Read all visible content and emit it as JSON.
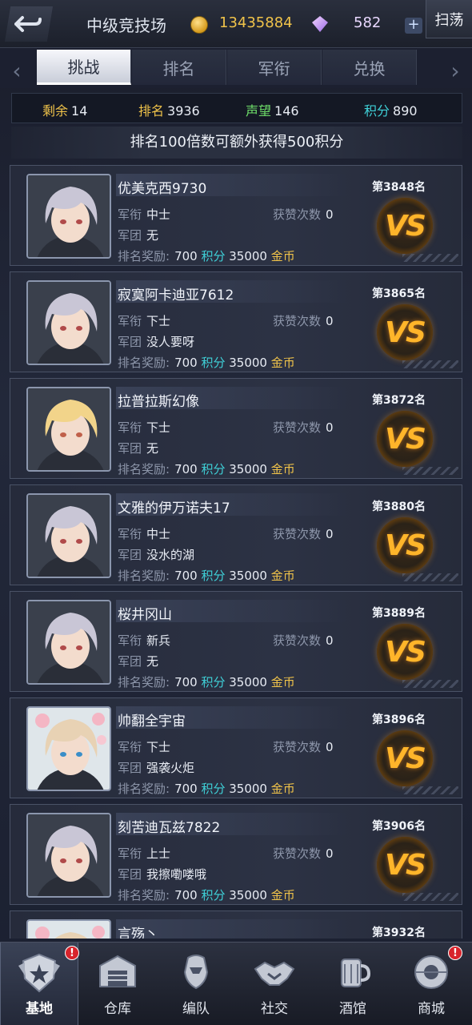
{
  "header": {
    "title": "中级竞技场",
    "gold": "13435884",
    "gems": "582",
    "plus": "+",
    "sweep": "扫荡"
  },
  "tabs": [
    {
      "label": "挑战",
      "active": true
    },
    {
      "label": "排名",
      "active": false
    },
    {
      "label": "军衔",
      "active": false
    },
    {
      "label": "兑换",
      "active": false
    }
  ],
  "stats": {
    "remaining_label": "剩余",
    "remaining": "14",
    "rank_label": "排名",
    "rank": "3936",
    "prestige_label": "声望",
    "prestige": "146",
    "points_label": "积分",
    "points": "890"
  },
  "notice": "排名100倍数可额外获得500积分",
  "labels": {
    "military_rank": "军衔",
    "legion": "军团",
    "likes": "获赞次数",
    "reward": "排名奖励:",
    "points_unit": "积分",
    "gold_unit": "金币",
    "vs": "VS"
  },
  "opponents": [
    {
      "name": "优美克西9730",
      "rank": "第3848名",
      "military_rank": "中士",
      "legion": "无",
      "likes": "0",
      "reward_points": "700",
      "reward_gold": "35000",
      "avatar": "silver-hair"
    },
    {
      "name": "寂寞阿卡迪亚7612",
      "rank": "第3865名",
      "military_rank": "下士",
      "legion": "没人要呀",
      "likes": "0",
      "reward_points": "700",
      "reward_gold": "35000",
      "avatar": "silver-hair"
    },
    {
      "name": "拉普拉斯幻像",
      "rank": "第3872名",
      "military_rank": "下士",
      "legion": "无",
      "likes": "0",
      "reward_points": "700",
      "reward_gold": "35000",
      "avatar": "blonde"
    },
    {
      "name": "文雅的伊万诺夫17",
      "rank": "第3880名",
      "military_rank": "中士",
      "legion": "没水的湖",
      "likes": "0",
      "reward_points": "700",
      "reward_gold": "35000",
      "avatar": "silver-hair"
    },
    {
      "name": "桜井冈山",
      "rank": "第3889名",
      "military_rank": "新兵",
      "legion": "无",
      "likes": "0",
      "reward_points": "700",
      "reward_gold": "35000",
      "avatar": "silver-hair"
    },
    {
      "name": "帅翻全宇宙",
      "rank": "第3896名",
      "military_rank": "下士",
      "legion": "强袭火炬",
      "likes": "0",
      "reward_points": "700",
      "reward_gold": "35000",
      "avatar": "flower-girl"
    },
    {
      "name": "刻苦迪瓦兹7822",
      "rank": "第3906名",
      "military_rank": "上士",
      "legion": "我擦嘞喽哦",
      "likes": "0",
      "reward_points": "700",
      "reward_gold": "35000",
      "avatar": "silver-hair"
    },
    {
      "name": "言殇丶",
      "rank": "第3932名",
      "military_rank": "",
      "legion": "",
      "likes": "",
      "reward_points": "",
      "reward_gold": "",
      "avatar": "flower-girl"
    }
  ],
  "nav": [
    {
      "label": "基地",
      "icon": "base-emblem-icon",
      "active": true,
      "badge": "!"
    },
    {
      "label": "仓库",
      "icon": "warehouse-icon",
      "active": false,
      "badge": ""
    },
    {
      "label": "编队",
      "icon": "formation-icon",
      "active": false,
      "badge": ""
    },
    {
      "label": "社交",
      "icon": "handshake-icon",
      "active": false,
      "badge": ""
    },
    {
      "label": "酒馆",
      "icon": "tavern-icon",
      "active": false,
      "badge": ""
    },
    {
      "label": "商城",
      "icon": "shop-icon",
      "active": false,
      "badge": "!"
    }
  ],
  "colors": {
    "gold": "#f0c34a",
    "cyan": "#3fd1d8",
    "remaining": "#f0c34a",
    "rank": "#f0c34a",
    "prestige": "#6fe06a",
    "points": "#3fd1d8",
    "vs": "#ffb52a",
    "badge": "#d8242c"
  }
}
